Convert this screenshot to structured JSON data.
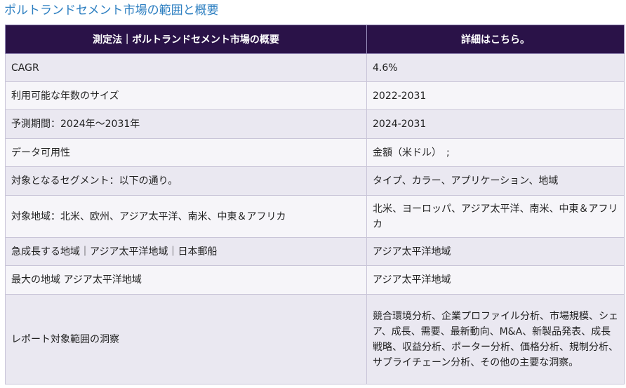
{
  "page": {
    "title": "ポルトランドセメント市場の範囲と概要"
  },
  "table": {
    "headers": [
      "測定法｜ポルトランドセメント市場の概要",
      "詳細はこちら。"
    ],
    "rows": [
      [
        "CAGR",
        "4.6%"
      ],
      [
        "利用可能な年数のサイズ",
        "2022-2031"
      ],
      [
        "予測期間：2024年～2031年",
        "2024-2031"
      ],
      [
        "データ可用性",
        "金額（米ドル）　;"
      ],
      [
        "対象となるセグメント：以下の通り。",
        "タイプ、カラー、アプリケーション、地域"
      ],
      [
        "対象地域：北米、欧州、アジア太平洋、南米、中東＆アフリカ",
        "北米、ヨーロッパ、アジア太平洋、南米、中東＆アフリカ"
      ],
      [
        "急成長する地域｜アジア太平洋地域｜日本郵船",
        "アジア太平洋地域"
      ],
      [
        "最大の地域 アジア太平洋地域",
        "アジア太平洋地域"
      ],
      [
        "レポート対象範囲の洞察",
        "競合環境分析、企業プロファイル分析、市場規模、シェア、成長、需要、最新動向、M&A、新製品発表、成長戦略、収益分析、ポーター分析、価格分析、規制分析、サプライチェーン分析、その他の主要な洞察。"
      ]
    ]
  },
  "colors": {
    "title": "#2d7fc1",
    "header_bg": "#2a1248",
    "row_odd": "#eae8f1",
    "row_even": "#f6f5f9",
    "border": "#c9c5d8"
  }
}
